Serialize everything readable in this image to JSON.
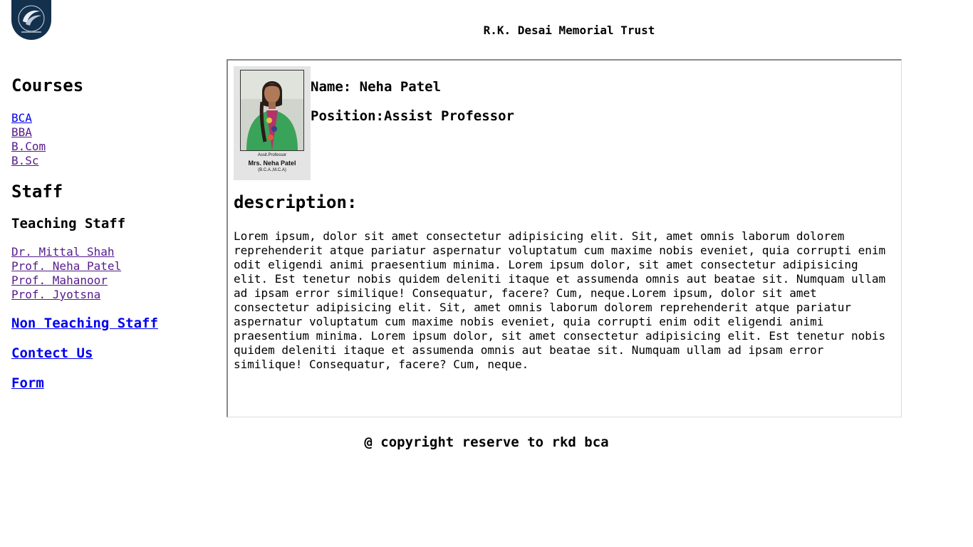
{
  "header": {
    "title": "R.K. Desai Memorial Trust",
    "logo_icon": "college-emblem-icon"
  },
  "sidebar": {
    "courses_heading": "Courses",
    "courses": [
      "BCA",
      "BBA",
      "B.Com",
      "B.Sc"
    ],
    "staff_heading": "Staff",
    "teaching_heading": "Teaching Staff",
    "teaching_staff": [
      "Dr. Mittal Shah",
      "Prof. Neha Patel",
      "Prof. Mahanoor",
      "Prof. Jyotsna"
    ],
    "non_teaching_link": "Non Teaching Staff",
    "contact_link": "Contect Us",
    "form_link": "Form"
  },
  "profile": {
    "card": {
      "role": "Assit.Professor",
      "name": "Mrs. Neha Patel",
      "degrees": "(B.C.A.,M.C.A)"
    },
    "name_line": "Name: Neha Patel",
    "position_line": "Position:Assist Professor",
    "description_heading": "description:",
    "description": "Lorem ipsum, dolor sit amet consectetur adipisicing elit. Sit, amet omnis laborum dolorem reprehenderit atque pariatur aspernatur voluptatum cum maxime nobis eveniet, quia corrupti enim odit eligendi animi praesentium minima. Lorem ipsum dolor, sit amet consectetur adipisicing elit. Est tenetur nobis quidem deleniti itaque et assumenda omnis aut beatae sit. Numquam ullam ad ipsam error similique! Consequatur, facere? Cum, neque.Lorem ipsum, dolor sit amet consectetur adipisicing elit. Sit, amet omnis laborum dolorem reprehenderit atque pariatur aspernatur voluptatum cum maxime nobis eveniet, quia corrupti enim odit eligendi animi praesentium minima. Lorem ipsum dolor, sit amet consectetur adipisicing elit. Est tenetur nobis quidem deleniti itaque et assumenda omnis aut beatae sit. Numquam ullam ad ipsam error similique! Consequatur, facere? Cum, neque."
  },
  "footer": {
    "text": "@ copyright reserve to rkd bca"
  },
  "colors": {
    "link": "#0000ee",
    "visited_link": "#551a8b",
    "logo_bg": "#13304d"
  }
}
